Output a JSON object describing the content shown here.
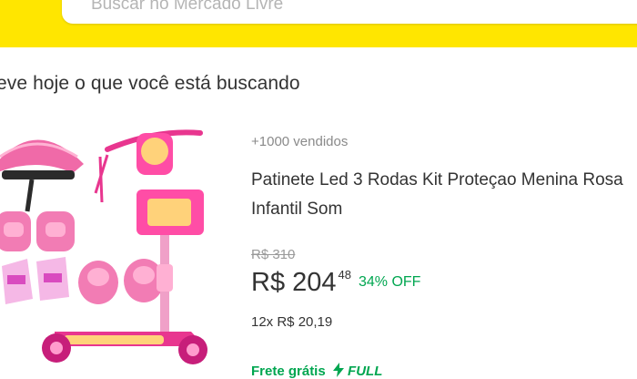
{
  "colors": {
    "header": "#ffe600",
    "accent_green": "#00a650",
    "text_dark": "#333333",
    "text_muted": "#8a8a8a"
  },
  "search": {
    "placeholder": "Buscar no Mercado Livre"
  },
  "section": {
    "title": "eve hoje o que você está buscando"
  },
  "product": {
    "image_icon": "scooter-kit-image",
    "sold": "+1000 vendidos",
    "title": "Patinete Led 3 Rodas Kit Proteçao Menina Rosa Infantil Som",
    "old_price": "R$ 310",
    "price": "R$ 204",
    "price_cents": "48",
    "discount": "34% OFF",
    "installments": "12x R$ 20,19",
    "shipping_label": "Frete grátis",
    "full_icon": "lightning-icon",
    "full_label": "FULL"
  }
}
